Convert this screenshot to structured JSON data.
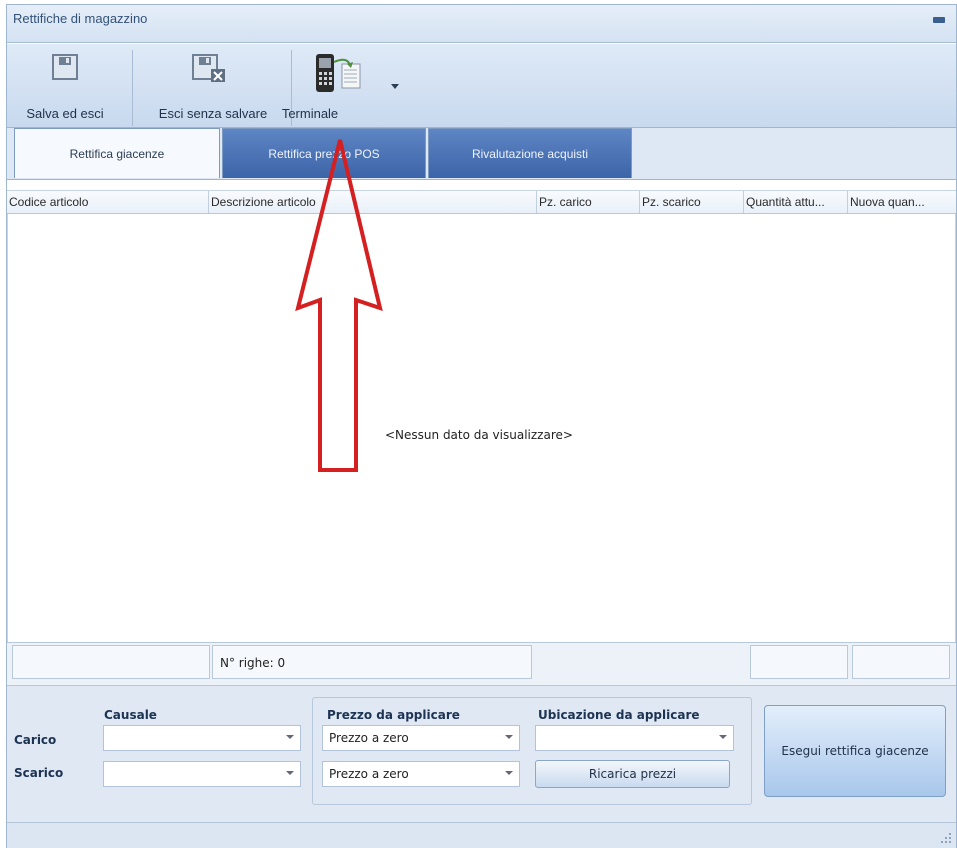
{
  "window": {
    "title": "Rettifiche di magazzino"
  },
  "toolbar": {
    "save_exit": "Salva ed esci",
    "exit_nosave": "Esci senza salvare",
    "terminal": "Terminale"
  },
  "tabs": [
    {
      "label": "Rettifica giacenze",
      "active": true
    },
    {
      "label": "Rettifica prezzo POS",
      "active": false
    },
    {
      "label": "Rivalutazione acquisti",
      "active": false
    }
  ],
  "grid": {
    "columns": [
      "Codice articolo",
      "Descrizione articolo",
      "Pz. carico",
      "Pz. scarico",
      "Quantità attu...",
      "Nuova quan..."
    ],
    "empty_text": "<Nessun dato da visualizzare>",
    "row_count": "N° righe: 0"
  },
  "form": {
    "causale_label": "Causale",
    "carico_label": "Carico",
    "scarico_label": "Scarico",
    "prezzo_label": "Prezzo da applicare",
    "prezzo_carico": "Prezzo a zero",
    "prezzo_scarico": "Prezzo a zero",
    "ubicazione_label": "Ubicazione da applicare",
    "ricarica_button": "Ricarica prezzi",
    "esegui_button": "Esegui rettifica giacenze"
  },
  "colors": {
    "annotation_arrow": "#d42020",
    "tab_inactive": "#4a72b6"
  }
}
